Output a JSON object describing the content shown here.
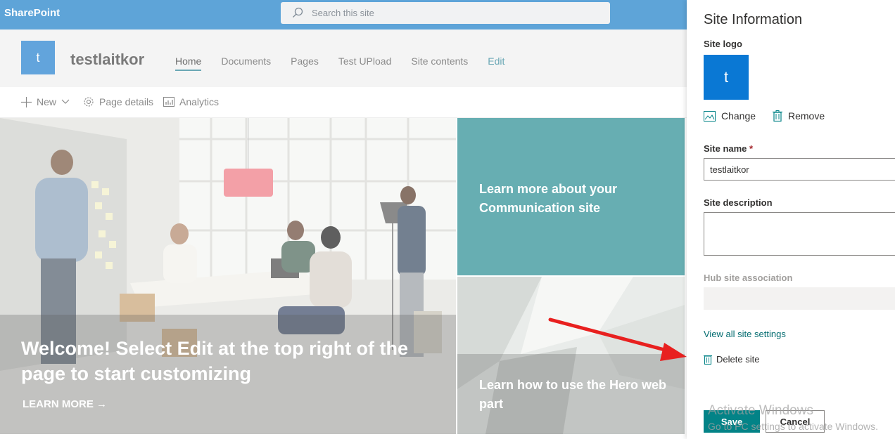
{
  "suitebar": {
    "brand": "SharePoint",
    "search_placeholder": "Search this site"
  },
  "site": {
    "logo_letter": "t",
    "title": "testlaitkor",
    "nav": [
      "Home",
      "Documents",
      "Pages",
      "Test UPload",
      "Site contents"
    ],
    "edit_label": "Edit"
  },
  "commands": {
    "new_label": "New",
    "page_details_label": "Page details",
    "analytics_label": "Analytics"
  },
  "hero": {
    "main_title": "Welcome! Select Edit at the top right of the page to start customizing",
    "main_link": "LEARN MORE →",
    "tile1_title": "Learn more about your Communication site",
    "tile2_title": "Learn how to use the Hero web part"
  },
  "panel": {
    "title": "Site Information",
    "logo_label": "Site logo",
    "logo_letter": "t",
    "change_label": "Change",
    "remove_label": "Remove",
    "name_label": "Site name",
    "name_required": "*",
    "name_value": "testlaitkor",
    "description_label": "Site description",
    "description_value": "",
    "hub_label": "Hub site association",
    "view_all_label": "View all site settings",
    "delete_label": "Delete site",
    "save_label": "Save",
    "cancel_label": "Cancel"
  },
  "watermark": {
    "line1": "Activate Windows",
    "line2": "Go to PC settings to activate Windows."
  },
  "colors": {
    "suitebar": "#5ea4d8",
    "accent_teal": "#038387",
    "annotation_arrow": "#e8201f"
  }
}
